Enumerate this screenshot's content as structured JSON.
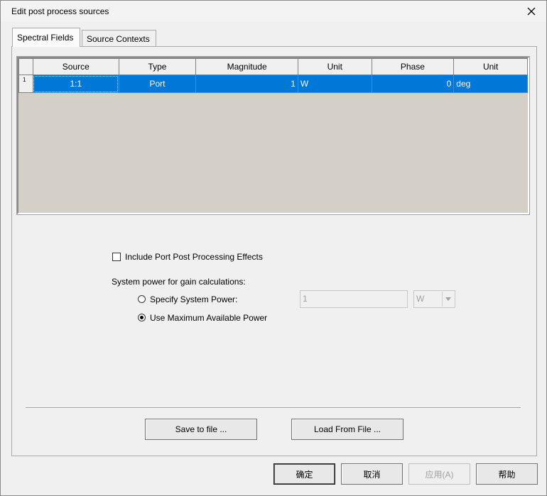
{
  "window": {
    "title": "Edit post process sources"
  },
  "tabs": [
    {
      "label": "Spectral Fields",
      "active": true
    },
    {
      "label": "Source Contexts",
      "active": false
    }
  ],
  "grid": {
    "columns": [
      "Source",
      "Type",
      "Magnitude",
      "Unit",
      "Phase",
      "Unit"
    ],
    "rows": [
      {
        "row_number": "1",
        "source": "1:1",
        "type": "Port",
        "magnitude": "1",
        "unit": "W",
        "phase": "0",
        "phase_unit": "deg"
      }
    ]
  },
  "options": {
    "include_port_label": "Include Port Post Processing Effects",
    "include_port_checked": false,
    "system_power_heading": "System power for gain calculations:",
    "specify_power_label": "Specify System Power:",
    "specify_power_selected": false,
    "power_value": "1",
    "power_unit": "W",
    "use_max_label": "Use Maximum Available Power",
    "use_max_selected": true
  },
  "buttons": {
    "save_to_file": "Save to file ...",
    "load_from_file": "Load From File ...",
    "ok": "确定",
    "cancel": "取消",
    "apply": "应用(A)",
    "help": "帮助"
  },
  "icons": {
    "close": "close-icon",
    "dropdown": "chevron-down-icon"
  }
}
